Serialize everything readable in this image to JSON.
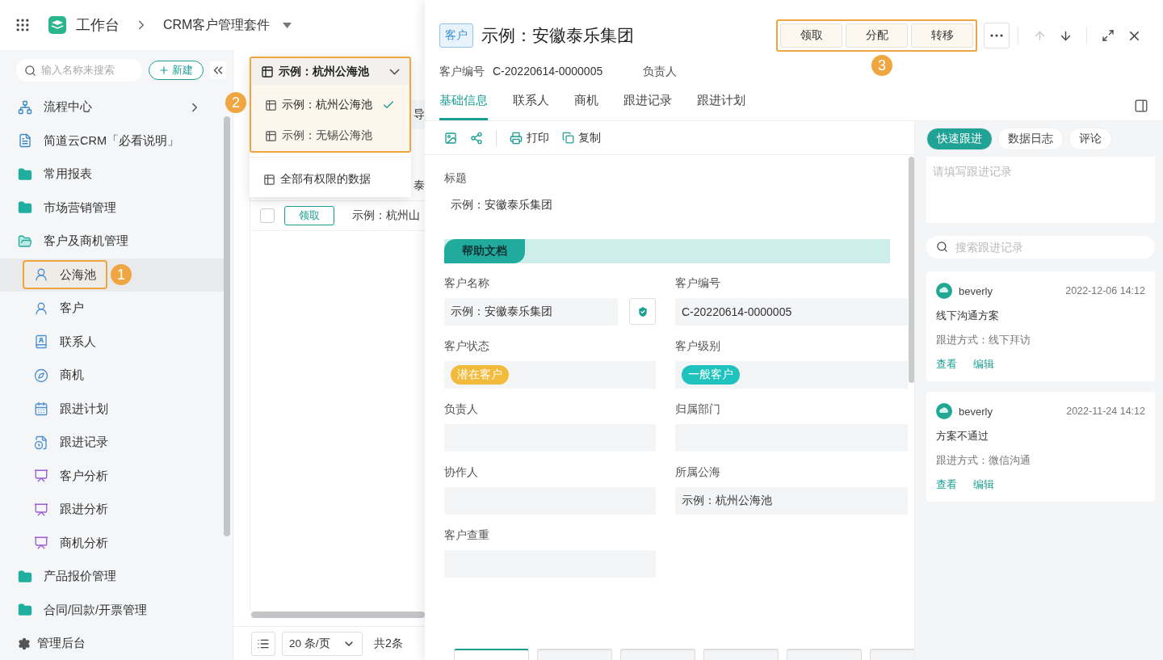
{
  "topbar": {
    "app": "工作台",
    "suite": "CRM客户管理套件"
  },
  "sidebar": {
    "search_placeholder": "输入名称来搜索",
    "new_button": "新建",
    "items": [
      {
        "label": "流程中心",
        "kind": "flow",
        "has_submenu": true
      },
      {
        "label": "简道云CRM「必看说明」",
        "kind": "doc",
        "has_submenu": false
      },
      {
        "label": "常用报表",
        "kind": "folder",
        "has_submenu": false
      },
      {
        "label": "市场营销管理",
        "kind": "folder",
        "has_submenu": false
      },
      {
        "label": "客户及商机管理",
        "kind": "folder",
        "has_submenu": false,
        "expanded": true,
        "children": [
          {
            "label": "公海池",
            "kind": "pool",
            "selected": true,
            "callout": "1"
          },
          {
            "label": "客户",
            "kind": "customer",
            "selected": false
          },
          {
            "label": "联系人",
            "kind": "contact",
            "selected": false
          },
          {
            "label": "商机",
            "kind": "opportunity",
            "selected": false
          },
          {
            "label": "跟进计划",
            "kind": "plan",
            "selected": false
          },
          {
            "label": "跟进记录",
            "kind": "record",
            "selected": false
          },
          {
            "label": "客户分析",
            "kind": "analysis",
            "selected": false
          },
          {
            "label": "跟进分析",
            "kind": "analysis",
            "selected": false
          },
          {
            "label": "商机分析",
            "kind": "analysis",
            "selected": false
          }
        ]
      },
      {
        "label": "产品报价管理",
        "kind": "folder",
        "has_submenu": false
      },
      {
        "label": "合同/回款/开票管理",
        "kind": "folder",
        "has_submenu": false
      }
    ],
    "footer": "管理后台"
  },
  "list": {
    "view_menu": {
      "current": "示例：杭州公海池",
      "callout": "2",
      "options": [
        {
          "label": "示例：杭州公海池",
          "selected": true
        },
        {
          "label": "示例：无锡公海池",
          "selected": false
        }
      ],
      "extra": "全部有权限的数据"
    },
    "header_fragment": "导",
    "rows": [
      {
        "title": "泰"
      },
      {
        "checked": false,
        "action": "领取",
        "title": "示例：杭州山"
      }
    ],
    "page_size": "20 条/页",
    "total": "共2条"
  },
  "drawer": {
    "tag": "客户",
    "title": "示例：安徽泰乐集团",
    "actions": [
      "领取",
      "分配",
      "转移"
    ],
    "callout": "3",
    "meta": [
      {
        "label": "客户编号",
        "value": "C-20220614-0000005"
      },
      {
        "label": "负责人"
      }
    ],
    "tabs": [
      {
        "label": "基础信息",
        "selected": true
      },
      {
        "label": "联系人",
        "selected": false
      },
      {
        "label": "商机",
        "selected": false
      },
      {
        "label": "跟进记录",
        "selected": false
      },
      {
        "label": "跟进计划",
        "selected": false
      }
    ],
    "toolbar": [
      {
        "kind": "print",
        "label": "打印"
      },
      {
        "kind": "copy",
        "label": "复制"
      }
    ],
    "title_field": {
      "label": "标题",
      "value": "示例：安徽泰乐集团"
    },
    "section": "帮助文档",
    "fields": [
      {
        "label": "客户名称",
        "kind": "text",
        "value": "示例：安徽泰乐集团",
        "has_shield": true
      },
      {
        "label": "客户编号",
        "kind": "text",
        "value": "C-20220614-0000005"
      },
      {
        "label": "客户状态",
        "kind": "tag",
        "value": "潜在客户",
        "color": "#f2bb3c"
      },
      {
        "label": "客户级别",
        "kind": "tag",
        "value": "一般客户",
        "color": "#1fc2bd"
      },
      {
        "label": "负责人",
        "kind": "text"
      },
      {
        "label": "归属部门",
        "kind": "text"
      },
      {
        "label": "协作人",
        "kind": "text"
      },
      {
        "label": "所属公海",
        "kind": "text",
        "value": "示例：杭州公海池"
      },
      {
        "label": "客户查重",
        "kind": "text"
      }
    ],
    "related_tabs": [
      {
        "selected": true
      },
      {
        "selected": false
      },
      {
        "selected": false
      },
      {
        "selected": false
      },
      {
        "selected": false
      },
      {
        "selected": false
      }
    ]
  },
  "follow": {
    "tabs": [
      {
        "label": "快速跟进",
        "selected": true
      },
      {
        "label": "数据日志",
        "selected": false
      },
      {
        "label": "评论",
        "selected": false
      }
    ],
    "input_placeholder": "请填写跟进记录",
    "search_placeholder": "搜索跟进记录",
    "records": [
      {
        "user": "beverly",
        "time": "2022-12-06 14:12",
        "title": "线下沟通方案",
        "method": "跟进方式：线下拜访",
        "actions": [
          "查看",
          "编辑"
        ]
      },
      {
        "user": "beverly",
        "time": "2022-11-24 14:12",
        "title": "方案不通过",
        "method": "跟进方式：微信沟通",
        "actions": [
          "查看",
          "编辑"
        ]
      }
    ]
  }
}
